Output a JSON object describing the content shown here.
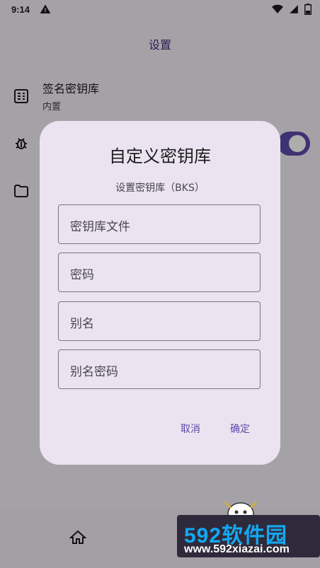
{
  "status_bar": {
    "time": "9:14",
    "icons": [
      "warning-icon",
      "wifi-icon",
      "signal-icon",
      "battery-icon"
    ]
  },
  "app": {
    "title": "设置"
  },
  "settings": {
    "items": [
      {
        "icon": "keystore-icon",
        "title": "签名密钥库",
        "subtitle": "内置"
      },
      {
        "icon": "bug-icon",
        "toggle": true
      },
      {
        "icon": "folder-icon"
      }
    ]
  },
  "dialog": {
    "title": "自定义密钥库",
    "subtitle": "设置密钥库（BKS）",
    "fields": [
      {
        "label": "密钥库文件"
      },
      {
        "label": "密码"
      },
      {
        "label": "别名"
      },
      {
        "label": "别名密码"
      }
    ],
    "cancel_label": "取消",
    "confirm_label": "确定"
  },
  "bottom_nav": {
    "home_icon": "home-icon"
  },
  "watermark": {
    "brand": "592软件园",
    "url": "www.592xiazai.com"
  },
  "colors": {
    "accent": "#5d4aa8",
    "title_purple": "#3b2f7a",
    "dialog_bg": "#ebe4f0",
    "scrim": "rgba(0,0,0,0.32)"
  }
}
